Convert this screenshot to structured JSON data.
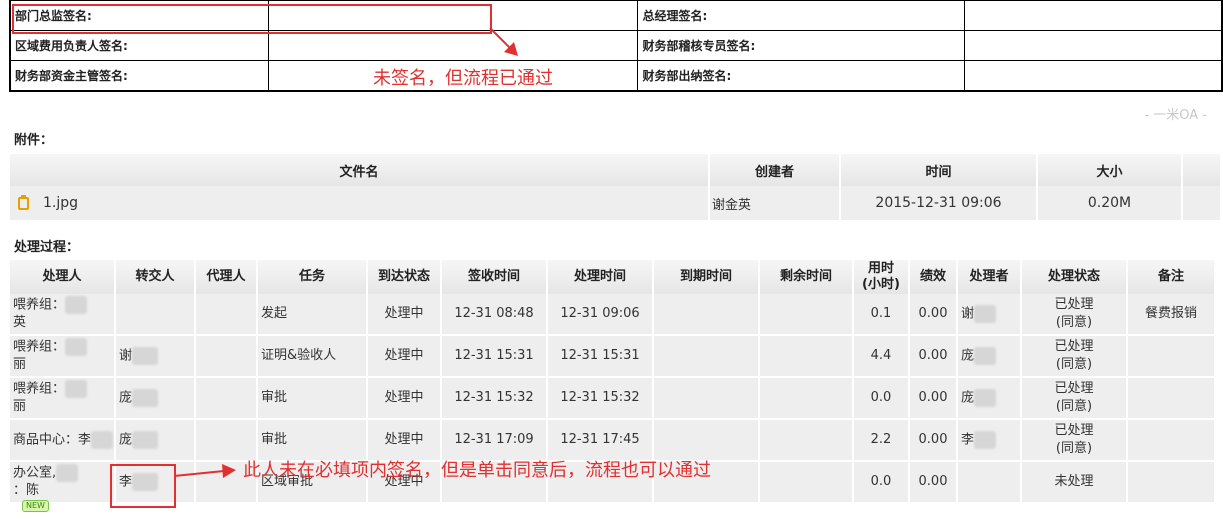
{
  "signatures": [
    [
      "部门总监签名:",
      "",
      "总经理签名:",
      ""
    ],
    [
      "区域费用负责人签名:",
      "",
      "财务部稽核专员签名:",
      ""
    ],
    [
      "财务部资金主管签名:",
      "",
      "财务部出纳签名:",
      ""
    ]
  ],
  "annotations": {
    "top_note": "未签名，但流程已通过",
    "bottom_note": "此人未在必填项内签名，但是单击同意后，流程也可以通过"
  },
  "watermark": "- 一米OA -",
  "attachments": {
    "label": "附件：",
    "headers": [
      "文件名",
      "创建者",
      "时间",
      "大小"
    ],
    "rows": [
      {
        "file": "1.jpg",
        "creator": "谢金英",
        "time": "2015-12-31 09:06",
        "size": "0.20M"
      }
    ]
  },
  "process": {
    "label": "处理过程：",
    "headers": [
      "处理人",
      "转交人",
      "代理人",
      "任务",
      "到达状态",
      "签收时间",
      "处理时间",
      "到期时间",
      "剩余时间",
      "用时(小时)",
      "绩效",
      "处理者",
      "处理状态",
      "备注"
    ],
    "header_line1": "用时",
    "header_line2": "(小时)",
    "rows": [
      {
        "handler_a": "喂养组：",
        "handler_b": "英",
        "transfer": "",
        "agent": "",
        "task": "发起",
        "arrive": "处理中",
        "sign": "12-31 08:48",
        "done": "12-31 09:06",
        "due": "",
        "remain": "",
        "hours": "0.1",
        "perf": "0.00",
        "processor": "谢",
        "status_a": "已处理",
        "status_b": "(同意)",
        "note": "餐费报销"
      },
      {
        "handler_a": "喂养组：",
        "handler_b": "丽",
        "transfer": "谢",
        "agent": "",
        "task": "证明&验收人",
        "arrive": "处理中",
        "sign": "12-31 15:31",
        "done": "12-31 15:31",
        "due": "",
        "remain": "",
        "hours": "4.4",
        "perf": "0.00",
        "processor": "庞",
        "status_a": "已处理",
        "status_b": "(同意)",
        "note": ""
      },
      {
        "handler_a": "喂养组：",
        "handler_b": "丽",
        "transfer": "庞",
        "agent": "",
        "task": "审批",
        "arrive": "处理中",
        "sign": "12-31 15:32",
        "done": "12-31 15:32",
        "due": "",
        "remain": "",
        "hours": "0.0",
        "perf": "0.00",
        "processor": "庞",
        "status_a": "已处理",
        "status_b": "(同意)",
        "note": ""
      },
      {
        "handler_a": "商品中心：李",
        "handler_b": "",
        "transfer": "庞",
        "agent": "",
        "task": "审批",
        "arrive": "处理中",
        "sign": "12-31 17:09",
        "done": "12-31 17:45",
        "due": "",
        "remain": "",
        "hours": "2.2",
        "perf": "0.00",
        "processor": "李",
        "status_a": "已处理",
        "status_b": "(同意)",
        "note": ""
      },
      {
        "handler_a": "办公室,",
        "handler_b": "：陈",
        "transfer": "李",
        "agent": "",
        "task": "区域审批",
        "arrive": "处理中",
        "sign": "",
        "done": "",
        "due": "",
        "remain": "",
        "hours": "0.0",
        "perf": "0.00",
        "processor": "",
        "status_a": "未处理",
        "status_b": "",
        "note": ""
      }
    ],
    "new_badge": "NEW"
  },
  "colors": {
    "annotation_red": "#e03030",
    "file_icon": "#e6a000"
  }
}
